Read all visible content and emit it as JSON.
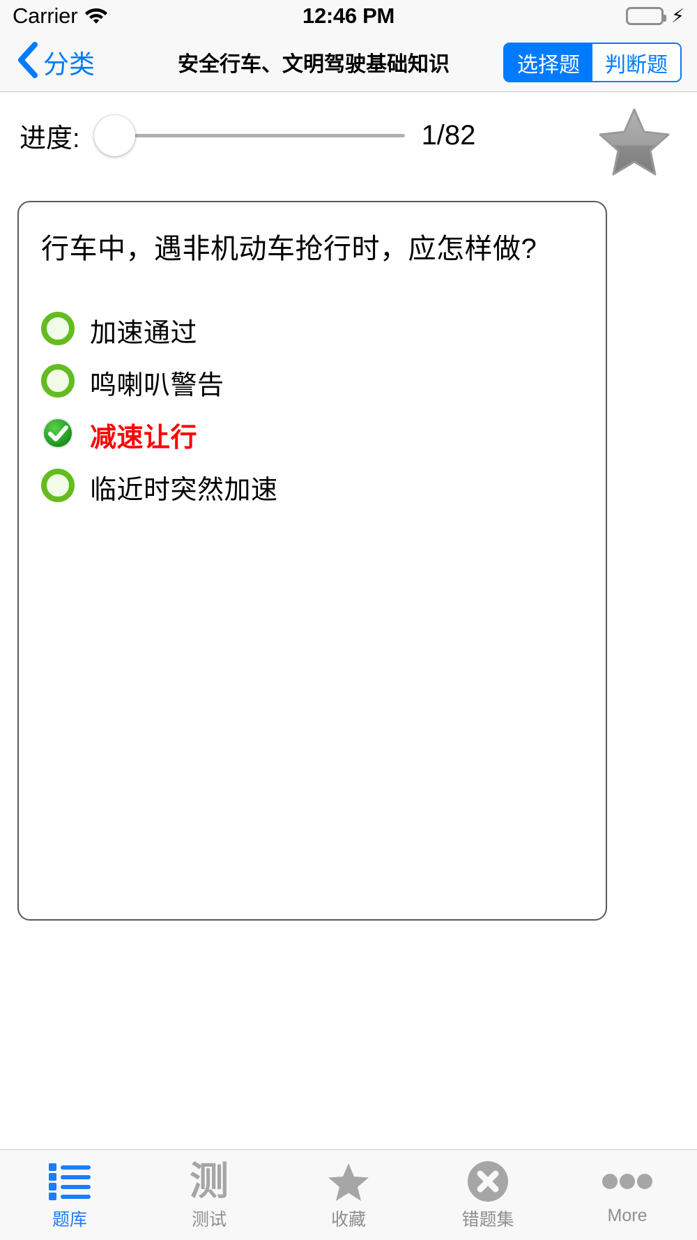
{
  "status_bar": {
    "carrier": "Carrier",
    "wifi_icon": "wifi-icon",
    "time": "12:46 PM",
    "battery_icon": "battery-icon",
    "charging_icon": "lightning-bolt-icon"
  },
  "nav_bar": {
    "back_icon": "chevron-left-icon",
    "back_label": "分类",
    "title": "安全行车、文明驾驶基础知识",
    "segments": [
      {
        "label": "选择题",
        "selected": true
      },
      {
        "label": "判断题",
        "selected": false
      }
    ]
  },
  "progress": {
    "label": "进度:",
    "count": "1/82",
    "current": 1,
    "total": 82,
    "favorite_icon": "star-icon",
    "favorited": false
  },
  "question": {
    "text": "行车中，遇非机动车抢行时，应怎样做?",
    "options": [
      {
        "label": "加速通过",
        "state": "unselected",
        "icon": "radio-circle-icon"
      },
      {
        "label": "鸣喇叭警告",
        "state": "unselected",
        "icon": "radio-circle-icon"
      },
      {
        "label": "减速让行",
        "state": "correct",
        "icon": "check-circle-icon"
      },
      {
        "label": "临近时突然加速",
        "state": "unselected",
        "icon": "radio-circle-icon"
      }
    ]
  },
  "tab_bar": {
    "items": [
      {
        "label": "题库",
        "icon": "list-icon",
        "active": true
      },
      {
        "label": "测试",
        "icon": "ce-character-icon",
        "active": false
      },
      {
        "label": "收藏",
        "icon": "star-icon",
        "active": false
      },
      {
        "label": "错题集",
        "icon": "x-circle-icon",
        "active": false
      },
      {
        "label": "More",
        "icon": "ellipsis-icon",
        "active": false
      }
    ]
  },
  "colors": {
    "accent_blue": "#007aff",
    "tab_active_blue": "#1a7dfd",
    "correct_red": "#ff0000",
    "option_green": "#64bc20",
    "check_green": "#2e9a2e",
    "battery_green": "#4cd964",
    "inactive_gray": "#8e8e93"
  },
  "misc": {
    "ce_glyph": "测"
  }
}
